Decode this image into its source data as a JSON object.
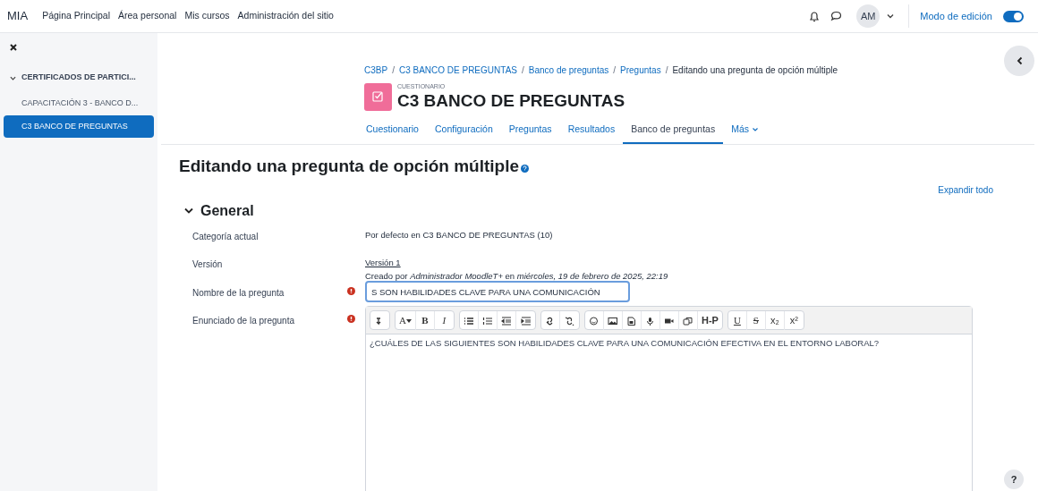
{
  "navbar": {
    "brand": "MIA",
    "links": [
      {
        "label": "Página Principal"
      },
      {
        "label": "Área personal"
      },
      {
        "label": "Mis cursos"
      },
      {
        "label": "Administración del sitio"
      }
    ],
    "avatar": "AM",
    "edit_mode": {
      "label": "Modo de edición",
      "on": true
    }
  },
  "sidebar": {
    "items": [
      {
        "label": "CERTIFICADOS DE PARTICI...",
        "expanded": true,
        "selected": false,
        "children": [
          {
            "label": "CAPACITACIÓN 3 - BANCO D...",
            "selected": false
          },
          {
            "label": "C3 BANCO DE PREGUNTAS",
            "selected": true
          }
        ]
      }
    ]
  },
  "breadcrumb": [
    {
      "kind": "link",
      "label": "C3BP"
    },
    {
      "kind": "separator",
      "label": "/"
    },
    {
      "kind": "link",
      "label": "C3 BANCO DE PREGUNTAS"
    },
    {
      "kind": "separator",
      "label": "/"
    },
    {
      "kind": "link",
      "label": "Banco de preguntas"
    },
    {
      "kind": "separator",
      "label": "/"
    },
    {
      "kind": "link",
      "label": "Preguntas"
    },
    {
      "kind": "separator",
      "label": "/"
    },
    {
      "kind": "current",
      "label": "Editando una pregunta de opción múltiple"
    }
  ],
  "header": {
    "kicker": "CUESTIONARIO",
    "title": "C3 BANCO DE PREGUNTAS"
  },
  "tabs": [
    {
      "label": "Cuestionario",
      "selected": false
    },
    {
      "label": "Configuración",
      "selected": false
    },
    {
      "label": "Preguntas",
      "selected": false
    },
    {
      "label": "Resultados",
      "selected": false
    },
    {
      "label": "Banco de preguntas",
      "selected": true
    },
    {
      "label": "Más",
      "selected": false
    }
  ],
  "page_title": "Editando una pregunta de opción múltiple",
  "expand_all": "Expandir todo",
  "section": {
    "title": "General",
    "expanded": true
  },
  "fields": [
    {
      "kind": "static",
      "label": "Categoría actual",
      "lines": [
        "Por defecto en C3 BANCO DE PREGUNTAS (10)"
      ]
    },
    {
      "kind": "version",
      "label": "Versión",
      "version": "Versión 1",
      "lines": [
        "Creado por *Administrador MoodleT+* en *miércoles, 19 de febrero de 2025, 22:19*"
      ]
    },
    {
      "kind": "input",
      "label": "Nombre de la pregunta",
      "required": true,
      "value": "S SON HABILIDADES CLAVE PARA UNA COMUNICACIÓN"
    },
    {
      "kind": "editor",
      "label": "Enunciado de la pregunta",
      "required": true,
      "value": "¿CUÁLES DE LAS SIGUIENTES SON HABILIDADES CLAVE PARA UNA COMUNICACIÓN EFECTIVA EN EL ENTORNO LABORAL?"
    }
  ],
  "toolbar": [
    [
      {
        "kind": "expand"
      }
    ],
    [
      {
        "kind": "fontcolor",
        "label": "A"
      },
      {
        "kind": "bold",
        "label": "B"
      },
      {
        "kind": "italic",
        "label": "I"
      }
    ],
    [
      {
        "kind": "bullets"
      },
      {
        "kind": "numbers"
      },
      {
        "kind": "outdent"
      },
      {
        "kind": "indent"
      }
    ],
    [
      {
        "kind": "link"
      },
      {
        "kind": "unlink"
      }
    ],
    [
      {
        "kind": "emoji"
      },
      {
        "kind": "image"
      },
      {
        "kind": "file"
      },
      {
        "kind": "mic"
      },
      {
        "kind": "video"
      },
      {
        "kind": "copy"
      },
      {
        "kind": "hp",
        "label": "H-P"
      }
    ],
    [
      {
        "kind": "underline",
        "label": "U"
      },
      {
        "kind": "strike",
        "label": "S"
      },
      {
        "kind": "plain",
        "label": "x₂"
      },
      {
        "kind": "plain",
        "label": "x²"
      }
    ]
  ],
  "help": "?"
}
